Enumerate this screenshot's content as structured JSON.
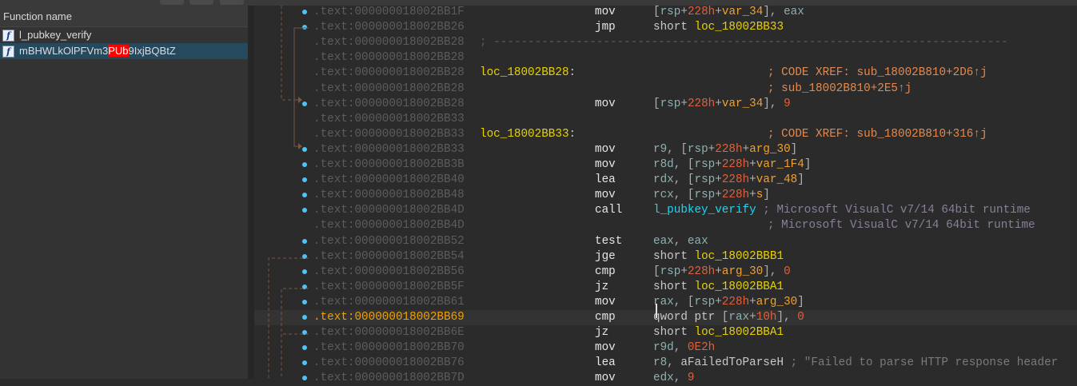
{
  "function_list": {
    "header": "Function name",
    "items": [
      {
        "icon": "function-icon",
        "name": "l_pubkey_verify",
        "selected": false
      },
      {
        "icon": "function-icon",
        "name_parts": [
          "mBHWLkOlPFVm3",
          "PUb",
          "9IxjBQBtZ"
        ],
        "selected": true
      }
    ]
  },
  "colors": {
    "label": "#e8d000",
    "register": "#8fb0b0",
    "number": "#e0603a",
    "variable": "#f0a030",
    "function": "#22d3ee",
    "bullet": "#4fc3f7"
  },
  "lines": [
    {
      "addr": ".text:000000018002BB1F",
      "dot": true,
      "mn": "mov",
      "ops": [
        [
          "br",
          "["
        ],
        [
          "reg",
          "rsp"
        ],
        [
          "br",
          "+"
        ],
        [
          "num",
          "228h"
        ],
        [
          "br",
          "+"
        ],
        [
          "var",
          "var_34"
        ],
        [
          "br",
          "], "
        ],
        [
          "reg",
          "eax"
        ]
      ]
    },
    {
      "addr": ".text:000000018002BB26",
      "dot": true,
      "mn": "jmp",
      "ops": [
        [
          "kw",
          "short "
        ],
        [
          "lbl",
          "loc_18002BB33"
        ]
      ]
    },
    {
      "addr": ".text:000000018002BB28",
      "sep": "; ---------------------------------------------------------------------------"
    },
    {
      "addr": ".text:000000018002BB28"
    },
    {
      "addr": ".text:000000018002BB28",
      "label": "loc_18002BB28",
      "cmt": "; CODE XREF: sub_18002B810+2D6↑j",
      "ctype": "xref"
    },
    {
      "addr": ".text:000000018002BB28",
      "cmt": "; sub_18002B810+2E5↑j",
      "ctype": "xref"
    },
    {
      "addr": ".text:000000018002BB28",
      "dot": true,
      "mn": "mov",
      "ops": [
        [
          "br",
          "["
        ],
        [
          "reg",
          "rsp"
        ],
        [
          "br",
          "+"
        ],
        [
          "num",
          "228h"
        ],
        [
          "br",
          "+"
        ],
        [
          "var",
          "var_34"
        ],
        [
          "br",
          "], "
        ],
        [
          "num",
          "9"
        ]
      ]
    },
    {
      "addr": ".text:000000018002BB33"
    },
    {
      "addr": ".text:000000018002BB33",
      "label": "loc_18002BB33",
      "cmt": "; CODE XREF: sub_18002B810+316↑j",
      "ctype": "xref"
    },
    {
      "addr": ".text:000000018002BB33",
      "dot": true,
      "mn": "mov",
      "ops": [
        [
          "reg",
          "r9"
        ],
        [
          "br",
          ", ["
        ],
        [
          "reg",
          "rsp"
        ],
        [
          "br",
          "+"
        ],
        [
          "num",
          "228h"
        ],
        [
          "br",
          "+"
        ],
        [
          "var",
          "arg_30"
        ],
        [
          "br",
          "]"
        ]
      ]
    },
    {
      "addr": ".text:000000018002BB3B",
      "dot": true,
      "mn": "mov",
      "ops": [
        [
          "reg",
          "r8d"
        ],
        [
          "br",
          ", ["
        ],
        [
          "reg",
          "rsp"
        ],
        [
          "br",
          "+"
        ],
        [
          "num",
          "228h"
        ],
        [
          "br",
          "+"
        ],
        [
          "var",
          "var_1F4"
        ],
        [
          "br",
          "]"
        ]
      ]
    },
    {
      "addr": ".text:000000018002BB40",
      "dot": true,
      "mn": "lea",
      "ops": [
        [
          "reg",
          "rdx"
        ],
        [
          "br",
          ", ["
        ],
        [
          "reg",
          "rsp"
        ],
        [
          "br",
          "+"
        ],
        [
          "num",
          "228h"
        ],
        [
          "br",
          "+"
        ],
        [
          "var",
          "var_48"
        ],
        [
          "br",
          "]"
        ]
      ]
    },
    {
      "addr": ".text:000000018002BB48",
      "dot": true,
      "mn": "mov",
      "ops": [
        [
          "reg",
          "rcx"
        ],
        [
          "br",
          ", ["
        ],
        [
          "reg",
          "rsp"
        ],
        [
          "br",
          "+"
        ],
        [
          "num",
          "228h"
        ],
        [
          "br",
          "+"
        ],
        [
          "var",
          "s"
        ],
        [
          "br",
          "]"
        ]
      ]
    },
    {
      "addr": ".text:000000018002BB4D",
      "dot": true,
      "mn": "call",
      "ops": [
        [
          "fn",
          "l_pubkey_verify"
        ],
        [
          "c-lib",
          " ; Microsoft VisualC v7/14 64bit runtime"
        ]
      ]
    },
    {
      "addr": ".text:000000018002BB4D",
      "cmt": "; Microsoft VisualC v7/14 64bit runtime",
      "ctype": "lib"
    },
    {
      "addr": ".text:000000018002BB52",
      "dot": true,
      "mn": "test",
      "ops": [
        [
          "reg",
          "eax"
        ],
        [
          "br",
          ", "
        ],
        [
          "reg",
          "eax"
        ]
      ]
    },
    {
      "addr": ".text:000000018002BB54",
      "dot": true,
      "mn": "jge",
      "ops": [
        [
          "kw",
          "short "
        ],
        [
          "lbl",
          "loc_18002BBB1"
        ]
      ]
    },
    {
      "addr": ".text:000000018002BB56",
      "dot": true,
      "mn": "cmp",
      "ops": [
        [
          "br",
          "["
        ],
        [
          "reg",
          "rsp"
        ],
        [
          "br",
          "+"
        ],
        [
          "num",
          "228h"
        ],
        [
          "br",
          "+"
        ],
        [
          "var",
          "arg_30"
        ],
        [
          "br",
          "], "
        ],
        [
          "num",
          "0"
        ]
      ]
    },
    {
      "addr": ".text:000000018002BB5F",
      "dot": true,
      "mn": "jz",
      "ops": [
        [
          "kw",
          "short "
        ],
        [
          "lbl",
          "loc_18002BBA1"
        ]
      ]
    },
    {
      "addr": ".text:000000018002BB61",
      "dot": true,
      "mn": "mov",
      "ops": [
        [
          "reg",
          "rax"
        ],
        [
          "br",
          ", ["
        ],
        [
          "reg",
          "rsp"
        ],
        [
          "br",
          "+"
        ],
        [
          "num",
          "228h"
        ],
        [
          "br",
          "+"
        ],
        [
          "var",
          "arg_30"
        ],
        [
          "br",
          "]"
        ]
      ]
    },
    {
      "addr": ".text:000000018002BB69",
      "dot": true,
      "current": true,
      "mn": "cmp",
      "ops": [
        [
          "kw",
          "qword ptr "
        ],
        [
          "br",
          "["
        ],
        [
          "reg",
          "rax"
        ],
        [
          "br",
          "+"
        ],
        [
          "num",
          "10h"
        ],
        [
          "br",
          "], "
        ],
        [
          "num",
          "0"
        ]
      ]
    },
    {
      "addr": ".text:000000018002BB6E",
      "dot": true,
      "mn": "jz",
      "ops": [
        [
          "kw",
          "short "
        ],
        [
          "lbl",
          "loc_18002BBA1"
        ]
      ]
    },
    {
      "addr": ".text:000000018002BB70",
      "dot": true,
      "mn": "mov",
      "ops": [
        [
          "reg",
          "r9d"
        ],
        [
          "br",
          ", "
        ],
        [
          "num",
          "0E2h"
        ]
      ]
    },
    {
      "addr": ".text:000000018002BB76",
      "dot": true,
      "mn": "lea",
      "ops": [
        [
          "reg",
          "r8"
        ],
        [
          "br",
          ", "
        ],
        [
          "kw",
          "aFailedToParseH"
        ],
        [
          "c-str",
          " ; \"Failed to parse HTTP response header"
        ]
      ]
    },
    {
      "addr": ".text:000000018002BB7D",
      "dot": true,
      "mn": "mov",
      "ops": [
        [
          "reg",
          "edx"
        ],
        [
          "br",
          ", "
        ],
        [
          "num",
          "9"
        ]
      ]
    }
  ]
}
